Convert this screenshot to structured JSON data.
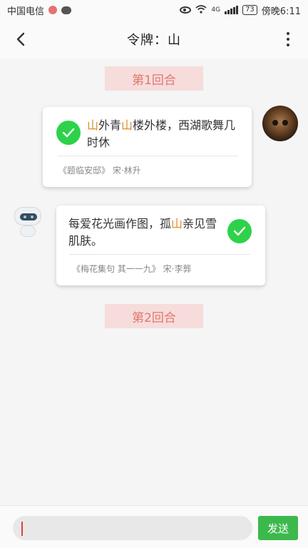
{
  "status_bar": {
    "carrier": "中国电信",
    "network": "4G",
    "battery": "73",
    "time": "傍晚6:11"
  },
  "header": {
    "title": "令牌：山"
  },
  "rounds": [
    {
      "label": "第1回合"
    },
    {
      "label": "第2回合"
    }
  ],
  "messages": [
    {
      "sender": "user",
      "verse_parts": [
        "山",
        "外青",
        "山",
        "楼外楼，西湖歌舞几时休"
      ],
      "source": "《题临安邸》 宋·林升"
    },
    {
      "sender": "bot",
      "verse_parts": [
        "每爱花光画作图，孤",
        "山",
        "亲见雪肌肤。"
      ],
      "source": "《梅花集句 其一一九》 宋·李龏"
    }
  ],
  "input": {
    "value": "",
    "placeholder": ""
  },
  "send_button": {
    "label": "发送"
  },
  "colors": {
    "highlight": "#e38b2c",
    "check": "#2ed24a",
    "send": "#3cb94c",
    "round_bg": "#f7dcdc",
    "round_text": "#e0786c"
  }
}
